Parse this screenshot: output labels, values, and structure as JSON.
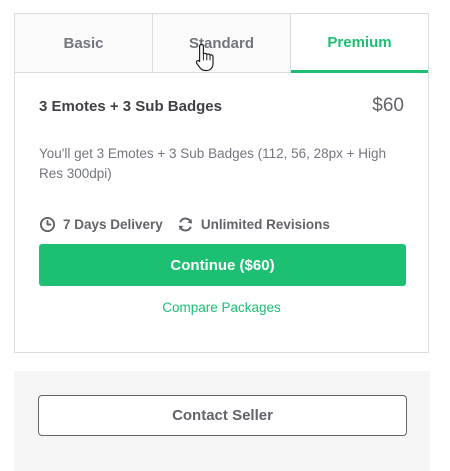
{
  "tabs": [
    {
      "label": "Basic",
      "active": false
    },
    {
      "label": "Standard",
      "active": false
    },
    {
      "label": "Premium",
      "active": true
    }
  ],
  "package": {
    "title": "3 Emotes + 3 Sub Badges",
    "price": "$60",
    "description": "You'll get 3 Emotes + 3 Sub Badges (112, 56, 28px + High Res 300dpi)",
    "features": [
      {
        "icon": "clock-icon",
        "label": "7 Days Delivery"
      },
      {
        "icon": "refresh-icon",
        "label": "Unlimited Revisions"
      }
    ],
    "continue_label": "Continue ($60)",
    "compare_label": "Compare Packages"
  },
  "contact": {
    "button_label": "Contact Seller"
  },
  "colors": {
    "accent": "#1dbf73",
    "text_dark": "#404145",
    "text_muted": "#74767e",
    "border": "#dadbdd"
  },
  "cursor": "hand-pointer-icon"
}
